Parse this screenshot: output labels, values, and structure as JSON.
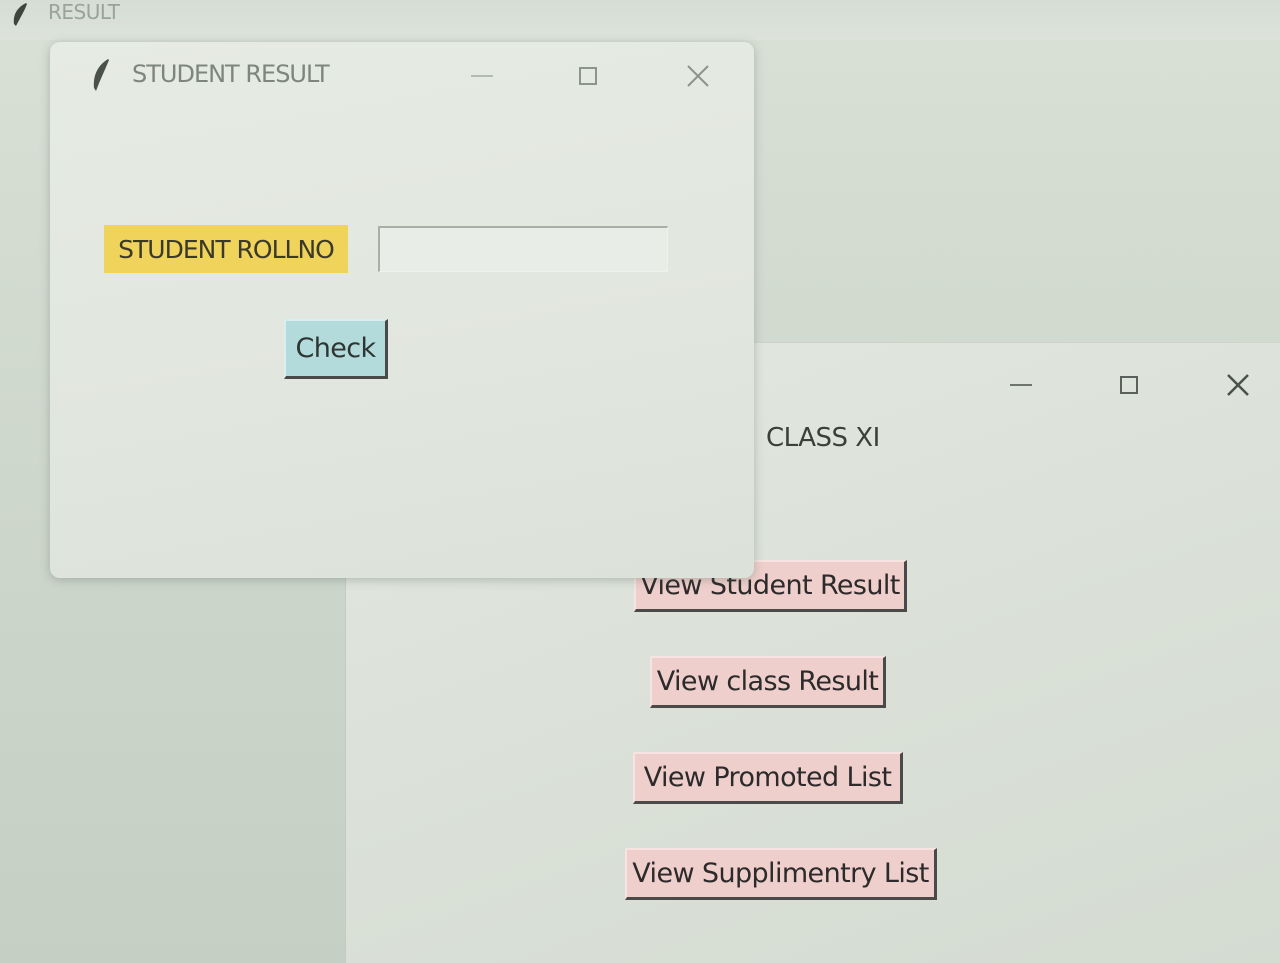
{
  "background_window": {
    "title": "RESULT",
    "icon": "feather-icon"
  },
  "main_window": {
    "heading": "CLASS XI",
    "controls": {
      "minimize_icon": "minimize-icon",
      "maximize_icon": "maximize-icon",
      "close_icon": "close-icon"
    },
    "buttons": {
      "view_student_result": "View Student Result",
      "view_class_result": "View class Result",
      "view_promoted_list": "View Promoted List",
      "view_supplimentry_list": "View Supplimentry List"
    },
    "button_color": "#efcfcc"
  },
  "student_window": {
    "title": "STUDENT RESULT",
    "icon": "feather-icon",
    "rollno_label": "STUDENT ROLLNO",
    "rollno_label_color": "#f0d35a",
    "rollno_value": "",
    "check_button": "Check",
    "check_button_color": "#b3dbdb"
  }
}
